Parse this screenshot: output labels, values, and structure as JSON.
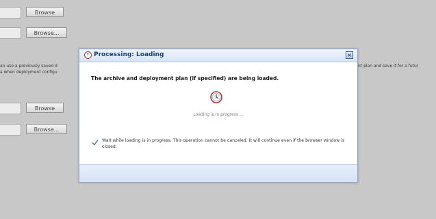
{
  "background_form": {
    "browse_labels": [
      "Browse",
      "Browse...",
      "Browse",
      "Browse..."
    ],
    "text_left_1": "an use a previously saved d",
    "text_left_2": "a when deployment configu",
    "text_right_1": "nt plan and save it for a futur"
  },
  "dialog": {
    "title": "Processing: Loading",
    "close_label": "×",
    "message": "The archive and deployment plan (if specified) are being loaded.",
    "progress_text": "Loading is in progress ...",
    "info_text": "Wait while loading is in progress. This operation cannot be canceled. It will continue even if the browser window is closed."
  },
  "colors": {
    "page_background": "#c8c8c8",
    "dialog_header": "#d9e5f5",
    "title_text": "#1e3f7a",
    "clock_accent": "#c03030"
  }
}
